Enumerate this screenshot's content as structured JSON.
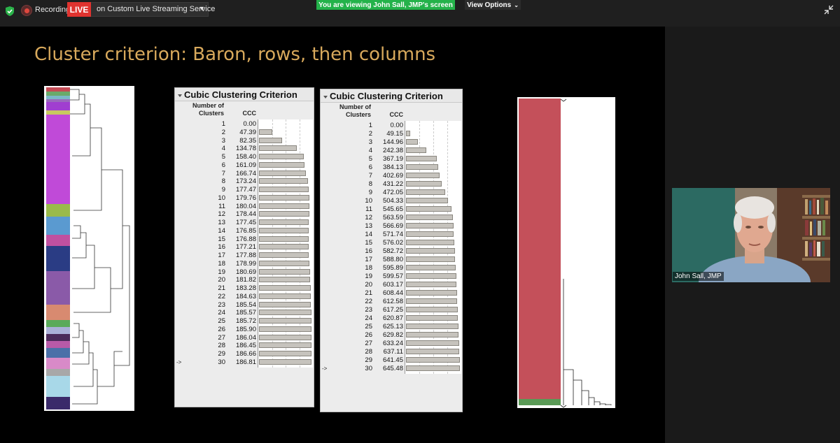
{
  "topbar": {
    "recording_label": "Recording",
    "live_badge": "LIVE",
    "stream_label": "on Custom Live Streaming Service",
    "viewing_banner": "You are viewing John Sall, JMP's screen",
    "view_options_label": "View Options"
  },
  "slide": {
    "title": "Cluster criterion: Baron, rows, then columns"
  },
  "ccc_left": {
    "title": "Cubic Clustering Criterion",
    "col_clusters": "Number of\nClusters",
    "col_ccc": "CCC",
    "selected_marker": "->",
    "max_value": 186.81,
    "rows": [
      {
        "n": "1",
        "v": "0.00"
      },
      {
        "n": "2",
        "v": "47.39"
      },
      {
        "n": "3",
        "v": "82.35"
      },
      {
        "n": "4",
        "v": "134.78"
      },
      {
        "n": "5",
        "v": "158.40"
      },
      {
        "n": "6",
        "v": "161.09"
      },
      {
        "n": "7",
        "v": "166.74"
      },
      {
        "n": "8",
        "v": "173.24"
      },
      {
        "n": "9",
        "v": "177.47"
      },
      {
        "n": "10",
        "v": "179.76"
      },
      {
        "n": "11",
        "v": "180.04"
      },
      {
        "n": "12",
        "v": "178.44"
      },
      {
        "n": "13",
        "v": "177.45"
      },
      {
        "n": "14",
        "v": "176.85"
      },
      {
        "n": "15",
        "v": "176.88"
      },
      {
        "n": "16",
        "v": "177.21"
      },
      {
        "n": "17",
        "v": "177.88"
      },
      {
        "n": "18",
        "v": "178.99"
      },
      {
        "n": "19",
        "v": "180.69"
      },
      {
        "n": "20",
        "v": "181.82"
      },
      {
        "n": "21",
        "v": "183.28"
      },
      {
        "n": "22",
        "v": "184.63"
      },
      {
        "n": "23",
        "v": "185.54"
      },
      {
        "n": "24",
        "v": "185.57"
      },
      {
        "n": "25",
        "v": "185.72"
      },
      {
        "n": "26",
        "v": "185.90"
      },
      {
        "n": "27",
        "v": "186.04"
      },
      {
        "n": "28",
        "v": "186.45"
      },
      {
        "n": "29",
        "v": "186.66"
      },
      {
        "n": "30",
        "v": "186.81"
      }
    ]
  },
  "ccc_right": {
    "title": "Cubic Clustering Criterion",
    "col_clusters": "Number of\nClusters",
    "col_ccc": "CCC",
    "selected_marker": "->",
    "max_value": 645.48,
    "rows": [
      {
        "n": "1",
        "v": "0.00"
      },
      {
        "n": "2",
        "v": "49.15"
      },
      {
        "n": "3",
        "v": "144.96"
      },
      {
        "n": "4",
        "v": "242.38"
      },
      {
        "n": "5",
        "v": "367.19"
      },
      {
        "n": "6",
        "v": "384.13"
      },
      {
        "n": "7",
        "v": "402.69"
      },
      {
        "n": "8",
        "v": "431.22"
      },
      {
        "n": "9",
        "v": "472.05"
      },
      {
        "n": "10",
        "v": "504.33"
      },
      {
        "n": "11",
        "v": "545.65"
      },
      {
        "n": "12",
        "v": "563.59"
      },
      {
        "n": "13",
        "v": "566.69"
      },
      {
        "n": "14",
        "v": "571.74"
      },
      {
        "n": "15",
        "v": "576.02"
      },
      {
        "n": "16",
        "v": "582.72"
      },
      {
        "n": "17",
        "v": "588.80"
      },
      {
        "n": "18",
        "v": "595.89"
      },
      {
        "n": "19",
        "v": "599.57"
      },
      {
        "n": "20",
        "v": "603.17"
      },
      {
        "n": "21",
        "v": "608.44"
      },
      {
        "n": "22",
        "v": "612.58"
      },
      {
        "n": "23",
        "v": "617.25"
      },
      {
        "n": "24",
        "v": "620.87"
      },
      {
        "n": "25",
        "v": "625.13"
      },
      {
        "n": "26",
        "v": "629.82"
      },
      {
        "n": "27",
        "v": "633.24"
      },
      {
        "n": "28",
        "v": "637.11"
      },
      {
        "n": "29",
        "v": "641.45"
      },
      {
        "n": "30",
        "v": "645.48"
      }
    ]
  },
  "video": {
    "participant_name": "John Sall, JMP"
  },
  "colors": {
    "live_red": "#e0332f",
    "viewing_green": "#24b24a",
    "title_gold": "#d8a95c",
    "bar_fill": "#c6c3bd",
    "column_cluster_red": "#c4505a",
    "column_cluster_green": "#5a9a56"
  }
}
